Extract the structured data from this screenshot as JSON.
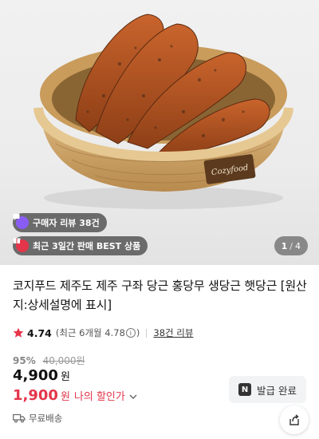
{
  "product_image": {
    "label": "Cozyfood",
    "review_chip": "구매자 리뷰 38건",
    "best_chip": "최근 3일간 판매 BEST 상품",
    "counter_current": "1",
    "counter_sep": "/",
    "counter_total": "4"
  },
  "product": {
    "title": "코지푸드 제주도 제주 구좌 당근 홍당무 생당근 햇당근 [원산지:상세설명에 표시]",
    "rating": "4.74",
    "rating_recent_prefix": "(최근 6개월 4.78",
    "rating_recent_suffix": ")",
    "review_link": "38건 리뷰",
    "discount_percent": "95%",
    "original_price": "40,000원",
    "price": "4,900",
    "price_unit": "원",
    "my_price": "1,900",
    "my_price_unit": "원",
    "my_price_label": "나의 할인가",
    "shipping": "무료배송"
  },
  "coupon": {
    "badge": "N",
    "label": "발급 완료"
  },
  "colors": {
    "accent_red": "#e4354a",
    "star": "#e8364a",
    "review_icon": "#8a5cf6"
  }
}
